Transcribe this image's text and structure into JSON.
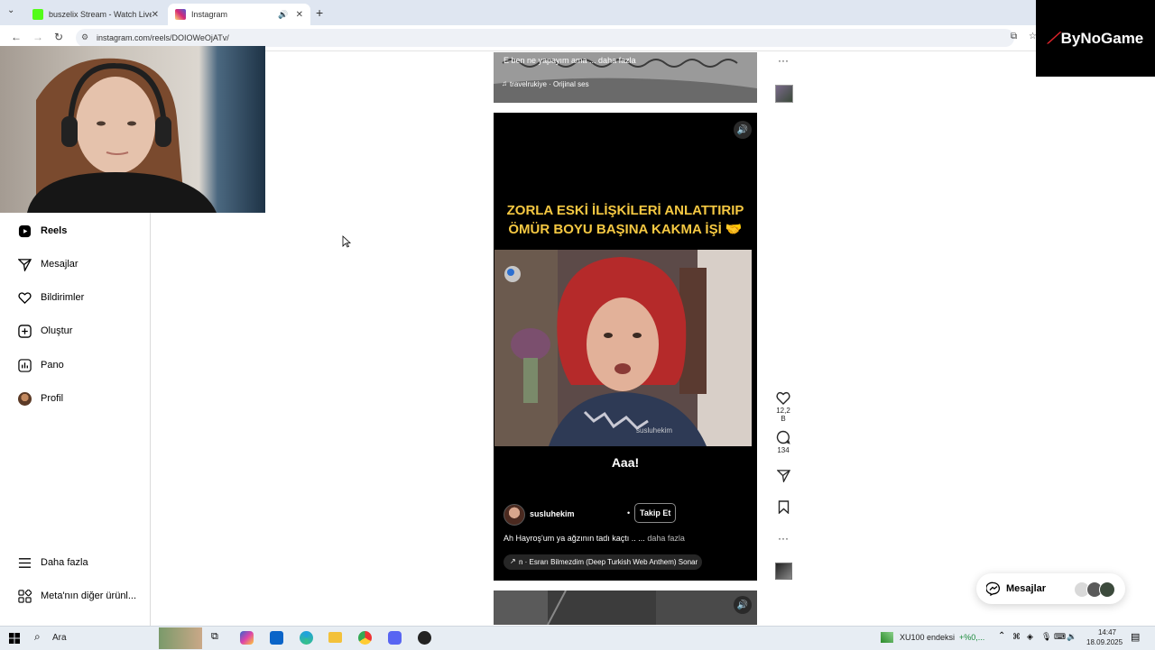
{
  "browser": {
    "tabs": [
      {
        "label": "buszelix Stream - Watch Live o",
        "favicon_color": "#53fc18"
      },
      {
        "label": "Instagram",
        "favicon_color": "#d62976"
      }
    ],
    "url": "instagram.com/reels/DOIOWeOjATv/"
  },
  "branding": {
    "text": "ByNoGame"
  },
  "sidebar": {
    "items": [
      {
        "label": "Reels",
        "icon": "reels-icon"
      },
      {
        "label": "Mesajlar",
        "icon": "send-icon"
      },
      {
        "label": "Bildirimler",
        "icon": "heart-icon"
      },
      {
        "label": "Oluştur",
        "icon": "plus-icon"
      },
      {
        "label": "Pano",
        "icon": "chart-icon"
      },
      {
        "label": "Profil",
        "icon": "avatar-icon"
      }
    ],
    "bottom": [
      {
        "label": "Daha fazla",
        "icon": "menu-icon"
      },
      {
        "label": "Meta'nın diğer ürünl...",
        "icon": "grid-icon"
      }
    ]
  },
  "reel_top": {
    "caption": "E ben ne yapayım ama ... daha fazla",
    "audio": "travelrukiye · Orijinal ses"
  },
  "reel_main": {
    "overlay_line1": "ZORLA ESKİ İLİŞKİLERİ ANLATTIRIP",
    "overlay_line2": "ÖMÜR BOYU BAŞINA KAKMA İŞİ 🤝",
    "watermark": "susluhekim",
    "subtitle": "Aaa!",
    "username": "susluhekim",
    "follow": "Takip Et",
    "caption": "Ah Hayroş'um ya ağzının tadı kaçtı .. ...",
    "more": "daha fazla",
    "audio": "n · Esrarı Bilmezdim (Deep Turkish Web Anthem)  Sonar C"
  },
  "actions": {
    "likes": "12,2 B",
    "comments": "134"
  },
  "messages": {
    "label": "Mesajlar"
  },
  "taskbar": {
    "search": "Ara",
    "stock_name": "XU100 endeksi",
    "stock_change": "+%0,...",
    "time": "14:47",
    "date": "18.09.2025"
  },
  "colors": {
    "overlay_text": "#f5c842",
    "ig_gradient_start": "#feda75",
    "ig_gradient_end": "#d62976"
  }
}
